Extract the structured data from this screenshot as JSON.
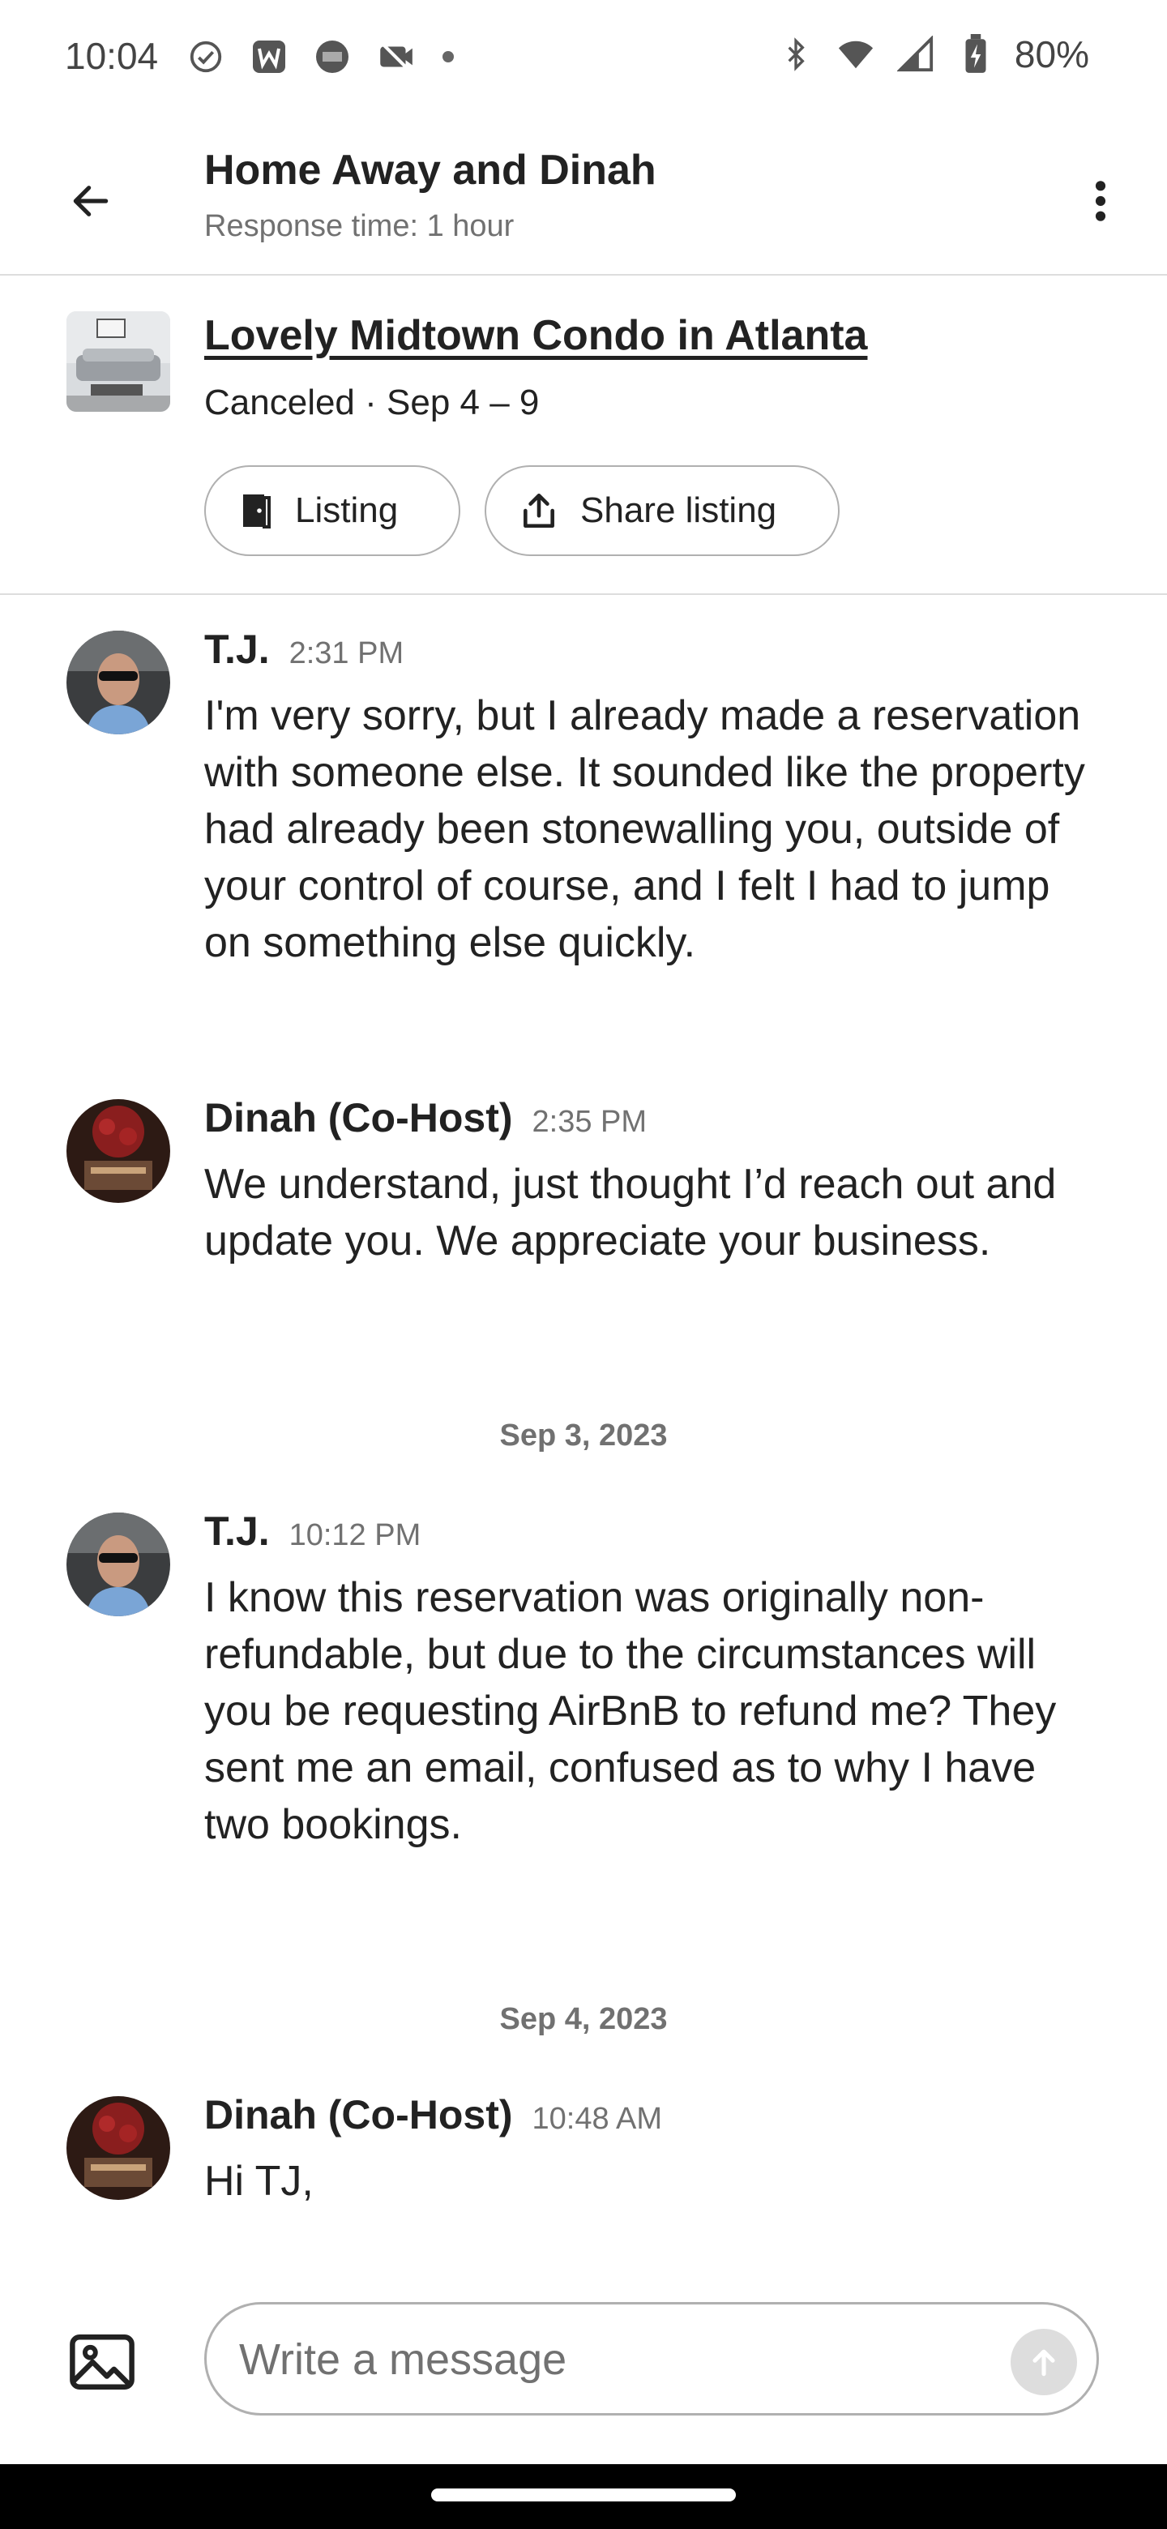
{
  "status_bar": {
    "time": "10:04",
    "battery": "80%",
    "left_icons": [
      "check-circle-icon",
      "w-app-icon",
      "amex-icon",
      "photo-off-icon",
      "dot-icon"
    ],
    "right_icons": [
      "bluetooth-icon",
      "wifi-icon",
      "signal-icon",
      "battery-charging-icon"
    ]
  },
  "header": {
    "title": "Home Away and Dinah",
    "subtitle": "Response time: 1 hour"
  },
  "listing": {
    "title": "Lovely Midtown Condo in Atlanta",
    "status": "Canceled · Sep 4 – 9",
    "listing_button": "Listing",
    "share_button": "Share listing"
  },
  "messages": [
    {
      "sender": "T.J.",
      "time": "2:31 PM",
      "text": "I'm very sorry, but I already made a reservation with someone else. It sounded like the property had already been stonewalling you, outside of your control of course, and I felt I had to jump on something else quickly."
    },
    {
      "sender": "Dinah (Co-Host)",
      "time": "2:35 PM",
      "text": "We understand, just thought I’d reach out and update you. We appreciate your business."
    },
    {
      "date": "Sep 3, 2023"
    },
    {
      "sender": "T.J.",
      "time": "10:12 PM",
      "text": "I know this reservation was originally non-refundable, but due to the circumstances will you be requesting AirBnB to refund me? They sent me an email, confused as to why I have two bookings."
    },
    {
      "date": "Sep 4, 2023"
    },
    {
      "sender": "Dinah (Co-Host)",
      "time": "10:48 AM",
      "text": "Hi TJ,"
    }
  ],
  "composer": {
    "placeholder": "Write a message"
  },
  "colors": {
    "text_primary": "#222222",
    "text_secondary": "#717171",
    "border": "#dddddd",
    "send_button_disabled": "#dddddd"
  }
}
